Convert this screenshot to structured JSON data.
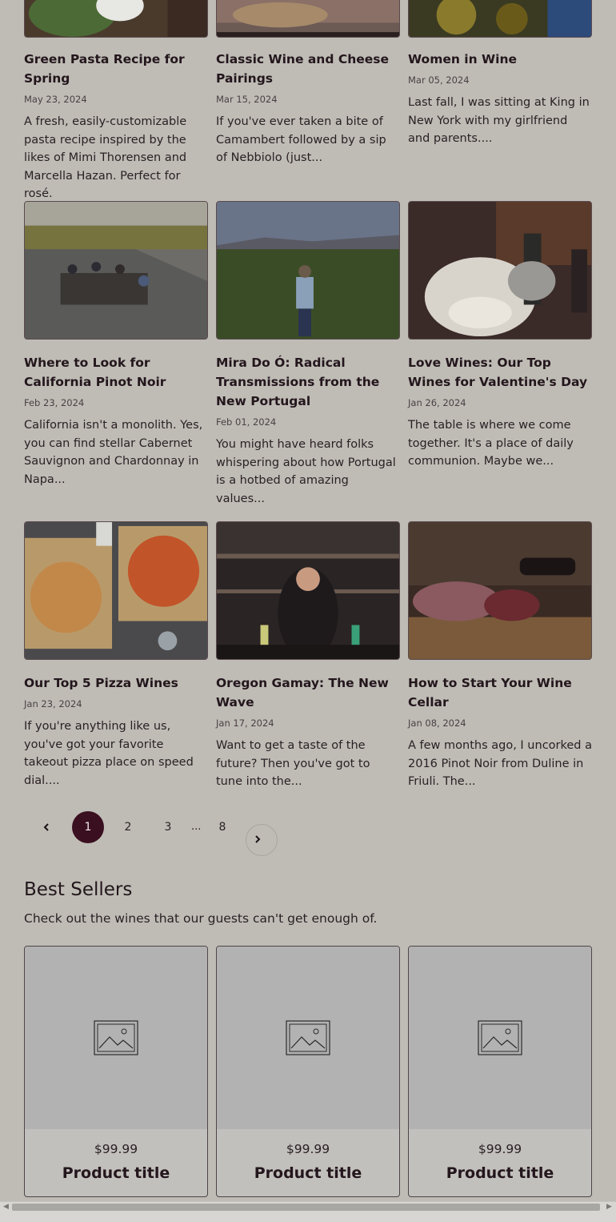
{
  "articles": [
    {
      "title": "Green Pasta Recipe for Spring",
      "date": "May 23, 2024",
      "excerpt": "A fresh, easily-customizable pasta recipe inspired by the likes of Mimi Thorensen and Marcella Hazan. Perfect for rosé."
    },
    {
      "title": "Classic Wine and Cheese Pairings",
      "date": "Mar 15, 2024",
      "excerpt": "If you've ever taken a bite of Camambert followed by a sip of Nebbiolo (just..."
    },
    {
      "title": "Women in Wine",
      "date": "Mar 05, 2024",
      "excerpt": "Last fall, I was sitting at King in New York with my girlfriend and parents...."
    },
    {
      "title": "Where to Look for California Pinot Noir",
      "date": "Feb 23, 2024",
      "excerpt": "California isn't a monolith. Yes, you can find stellar Cabernet Sauvignon and Chardonnay in Napa..."
    },
    {
      "title": "Mira Do Ó: Radical Transmissions from the New Portugal",
      "date": "Feb 01, 2024",
      "excerpt": "You might have heard folks whispering about how Portugal is a hotbed of amazing values..."
    },
    {
      "title": "Love Wines: Our Top Wines for Valentine's Day",
      "date": "Jan 26, 2024",
      "excerpt": "The table is where we come together. It's a place of daily communion. Maybe we..."
    },
    {
      "title": "Our Top 5 Pizza Wines",
      "date": "Jan 23, 2024",
      "excerpt": "If you're anything like us, you've got your favorite takeout pizza place on speed dial...."
    },
    {
      "title": "Oregon Gamay: The New Wave",
      "date": "Jan 17, 2024",
      "excerpt": "Want to get a taste of the future? Then you've got to tune into the..."
    },
    {
      "title": "How to Start Your Wine Cellar",
      "date": "Jan 08, 2024",
      "excerpt": "A few months ago, I uncorked a 2016 Pinot Noir from Duline in Friuli.  The..."
    }
  ],
  "pagination": {
    "pages": [
      "1",
      "2",
      "3"
    ],
    "ellipsis": "...",
    "last": "8",
    "prev_icon": "chevron-left-icon",
    "next_icon": "chevron-right-icon"
  },
  "best_sellers": {
    "title": "Best Sellers",
    "subtitle": "Check out the wines that our guests can't get enough of.",
    "products": [
      {
        "price": "$99.99",
        "title": "Product title"
      },
      {
        "price": "$99.99",
        "title": "Product title"
      },
      {
        "price": "$99.99",
        "title": "Product title"
      }
    ]
  }
}
